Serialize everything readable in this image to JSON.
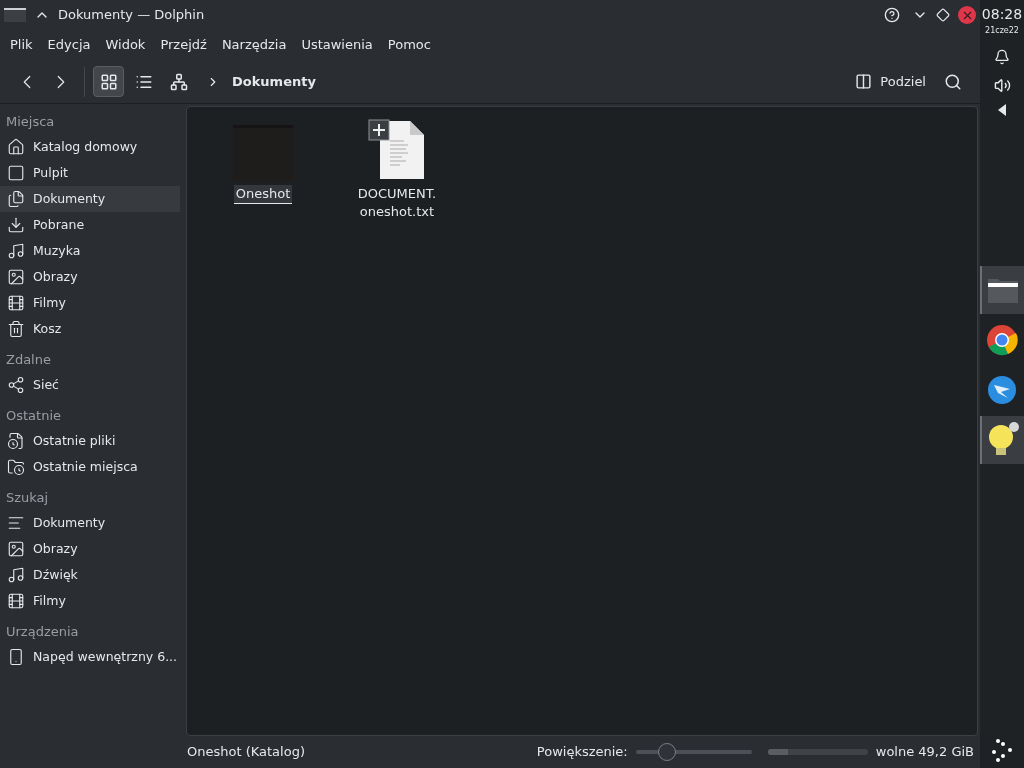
{
  "window": {
    "title": "Dokumenty — Dolphin"
  },
  "menu": [
    "Plik",
    "Edycja",
    "Widok",
    "Przejdź",
    "Narzędzia",
    "Ustawienia",
    "Pomoc"
  ],
  "view_modes": [
    {
      "selected": true
    },
    {
      "selected": false
    },
    {
      "selected": false
    }
  ],
  "breadcrumb": "Dokumenty",
  "split_button": "Podziel",
  "sidebar": [
    {
      "heading": "Miejsca",
      "items": [
        {
          "label": "Katalog domowy",
          "selected": false
        },
        {
          "label": "Pulpit",
          "selected": false
        },
        {
          "label": "Dokumenty",
          "selected": true
        },
        {
          "label": "Pobrane",
          "selected": false
        },
        {
          "label": "Muzyka",
          "selected": false
        },
        {
          "label": "Obrazy",
          "selected": false
        },
        {
          "label": "Filmy",
          "selected": false
        },
        {
          "label": "Kosz",
          "selected": false
        }
      ]
    },
    {
      "heading": "Zdalne",
      "items": [
        {
          "label": "Sieć",
          "selected": false
        }
      ]
    },
    {
      "heading": "Ostatnie",
      "items": [
        {
          "label": "Ostatnie pliki",
          "selected": false
        },
        {
          "label": "Ostatnie miejsca",
          "selected": false
        }
      ]
    },
    {
      "heading": "Szukaj",
      "items": [
        {
          "label": "Dokumenty",
          "selected": false
        },
        {
          "label": "Obrazy",
          "selected": false
        },
        {
          "label": "Dźwięk",
          "selected": false
        },
        {
          "label": "Filmy",
          "selected": false
        }
      ]
    },
    {
      "heading": "Urządzenia",
      "items": [
        {
          "label": "Napęd wewnętrzny 6...",
          "selected": false
        }
      ]
    }
  ],
  "files": [
    {
      "kind": "folder",
      "name": "Oneshot",
      "selected": true
    },
    {
      "kind": "text",
      "name": "DOCUMENT.\noneshot.txt",
      "selected": false
    }
  ],
  "status_bar": {
    "text": "Oneshot (Katalog)",
    "zoom_label": "Powiększenie:",
    "zoom": {
      "level": 0.27
    },
    "disk": {
      "level": 0.2
    },
    "free": "wolne 49,2 GiB"
  },
  "panel": {
    "time": "08:28",
    "date": "21cze22",
    "tasks": [
      {
        "active": true
      },
      {
        "active": false
      },
      {
        "active": false
      },
      {
        "active": true
      }
    ]
  }
}
